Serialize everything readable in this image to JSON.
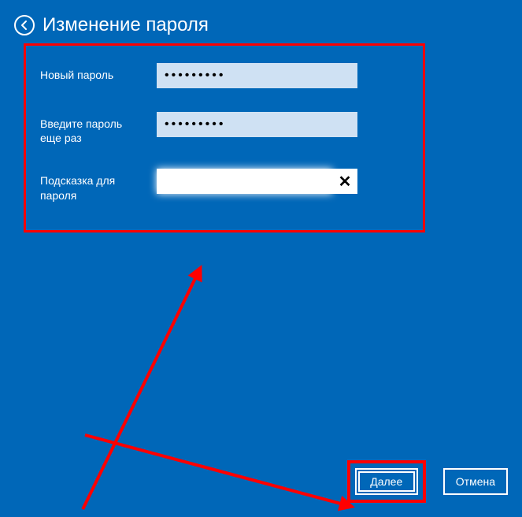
{
  "header": {
    "title": "Изменение пароля"
  },
  "form": {
    "new_password_label": "Новый пароль",
    "confirm_password_label": "Введите пароль еще раз",
    "hint_label": "Подсказка для пароля",
    "new_password_mask": "•••••••••",
    "confirm_password_mask": "•••••••••",
    "hint_value": ""
  },
  "buttons": {
    "next": "Далее",
    "cancel": "Отмена"
  }
}
